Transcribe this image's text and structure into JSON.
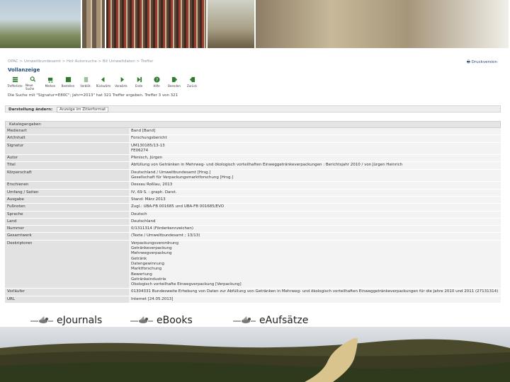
{
  "opac": {
    "breadcrumb": "OPAC > Umweltbundesamt > Hot Autorsuche > Bit Umweltdaten > Treffer",
    "print_label": "Druckversion",
    "page_title": "Vollanzeige",
    "toolbar": [
      "Trefferliste",
      "Neue Suche",
      "Merken",
      "Bestellen",
      "Vorblät.",
      "Rückwärts",
      "Vorwärts",
      "Ende",
      "Hilfe",
      "Beenden",
      "Zurück"
    ],
    "result_text": "Die Suche mit \"Signatur=E80C\"; Jahr=2013\" hat 321 Treffer ergeben. Treffer 3 von 321",
    "sort_label": "Darstellung ändern:",
    "sort_value": "Anzeige im Zitierformat",
    "table_title": "Katalogangaben",
    "records": [
      {
        "key": "Medienart",
        "lines": [
          "Band [Band]"
        ]
      },
      {
        "key": "Art/Inhalt",
        "lines": [
          "Forschungsbericht"
        ]
      },
      {
        "key": "Signatur",
        "lines": [
          "UM130185/13-13",
          "FE06274"
        ]
      },
      {
        "key": "Autor",
        "lines": [
          "Pfenisch, Jürgen"
        ]
      },
      {
        "key": "Titel",
        "lines": [
          "Abfüllung von Getränken in Mehrweg- und ökologisch vorteilhaften Einweggetränkeverpackungen : Berichtsjahr 2010 / von Jürgen Heinrich"
        ]
      },
      {
        "key": "Körperschaft",
        "lines": [
          "Deutschland / Umweltbundesamt [Hrsg.]",
          "Gesellschaft für Verpackungsmarktforschung [Hrsg.]"
        ]
      },
      {
        "key": "Erschienen",
        "lines": [
          "Dessau Roßlau, 2013"
        ]
      },
      {
        "key": "Umfang / Seiten",
        "lines": [
          "IV, 69 S. : graph. Darst."
        ]
      },
      {
        "key": "Ausgabe",
        "lines": [
          "Stand: März 2013"
        ]
      },
      {
        "key": "Fußnoten",
        "lines": [
          "Zugl.: UBA-FB 001685 und UBA-FB 001685/EVO"
        ]
      },
      {
        "key": "Sprache",
        "lines": [
          "Deutsch"
        ]
      },
      {
        "key": "Land",
        "lines": [
          "Deutschland"
        ]
      },
      {
        "key": "Nummer",
        "lines": [
          "0/1311314 (Förderkennzeichen)"
        ]
      },
      {
        "key": "Gesamtwerk",
        "lines": [
          "(Texte / Umweltbundesamt ; 13/13)"
        ]
      },
      {
        "key": "Deskriptoren",
        "lines": [
          "Verpackungsverordnung",
          "Getränkeverpackung",
          "Mehrwegverpackung",
          "Getränk",
          "Datengewinnung",
          "Marktforschung",
          "Bewertung",
          "Getränkeindustrie",
          "Ökologisch vorteilhafte Einwegverpackung [Verpackung]"
        ]
      },
      {
        "key": "Vorläufer",
        "lines": [
          "01304331 Bundesweite Erhebung von Daten zur Abfüllung von Getränken in Mehrweg- und ökologisch vorteilhaften Einweggetränkeverpackungen für die Jahre 2010 und 2011 (27131314)"
        ]
      },
      {
        "key": "URL",
        "lines": [
          "Internet [24.05.2013]"
        ]
      }
    ]
  },
  "links": [
    {
      "label": "eJournals"
    },
    {
      "label": "eBooks"
    },
    {
      "label": "eAufsätze"
    }
  ],
  "colors": {
    "link": "#1b5a9c",
    "title": "#1f4e7a"
  }
}
